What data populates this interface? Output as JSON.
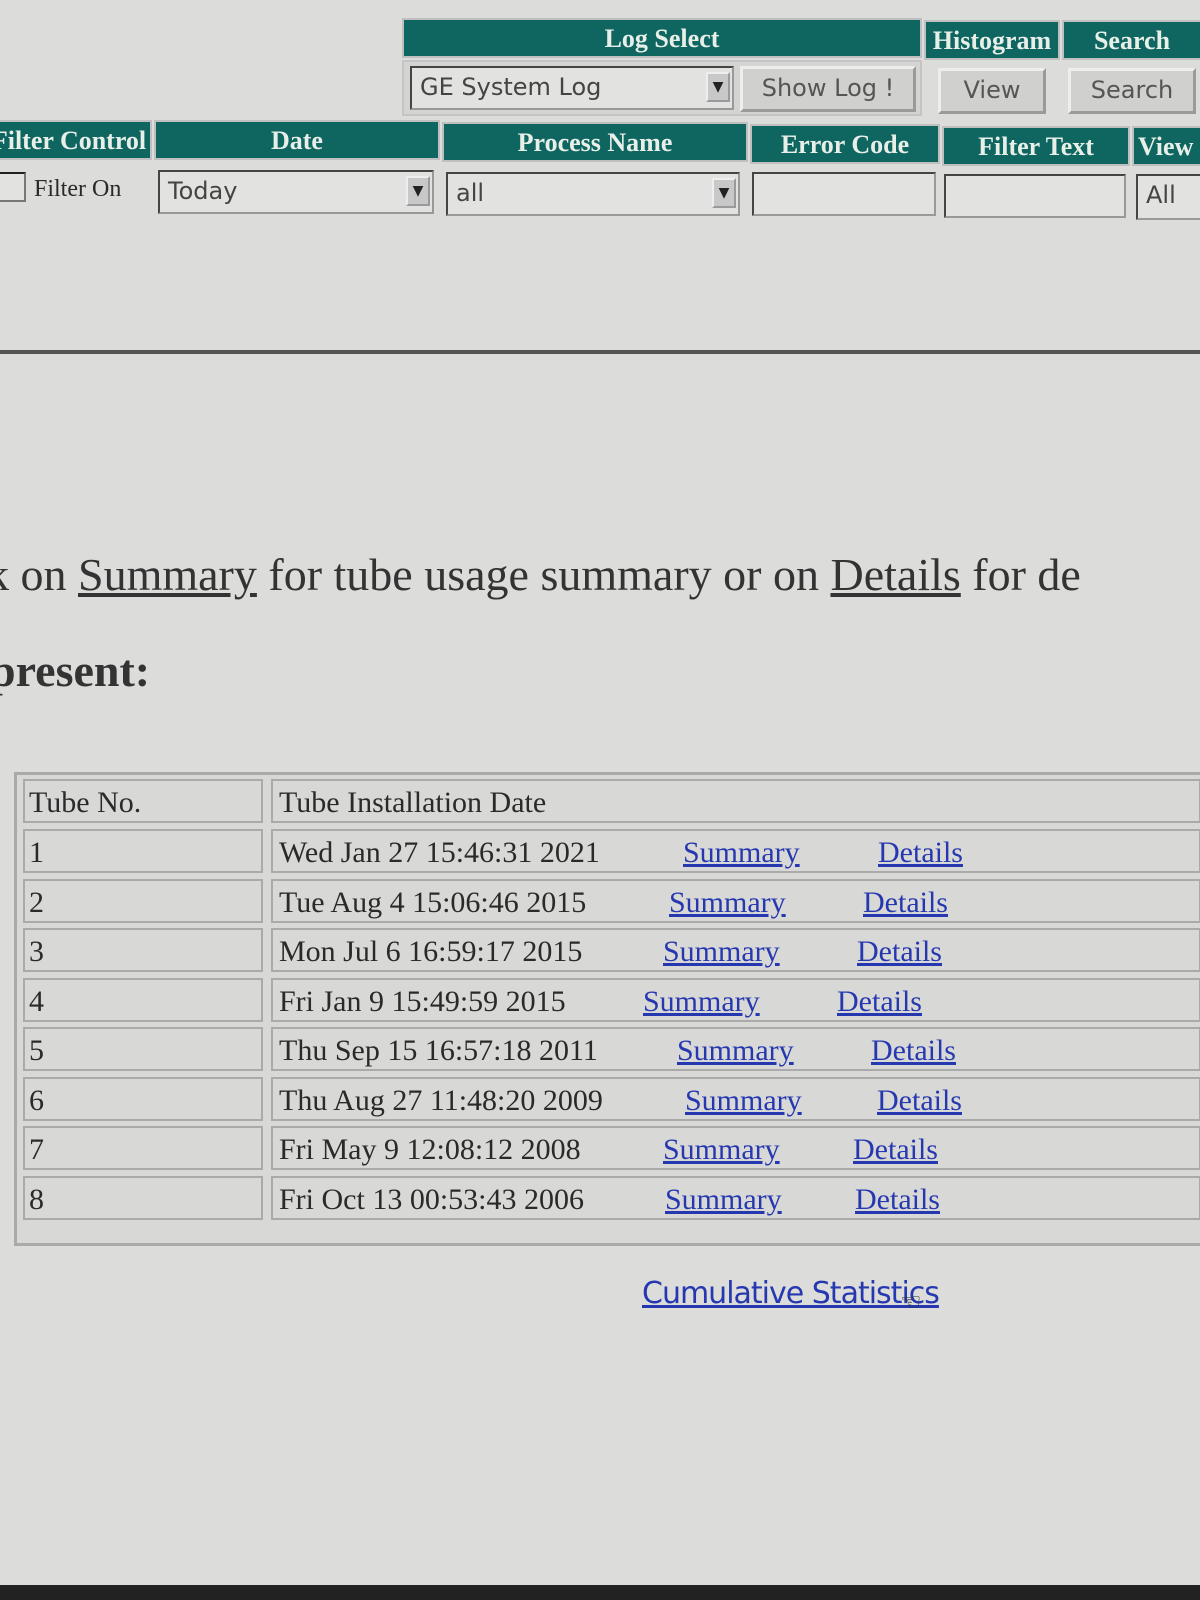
{
  "toolbar": {
    "log_select_header": "Log Select",
    "histogram_header": "Histogram",
    "search_header": "Search",
    "log_select_value": "GE System Log",
    "show_log_label": "Show Log !",
    "view_label": "View",
    "search_label": "Search"
  },
  "filters": {
    "filter_control_header": "Filter Control",
    "date_header": "Date",
    "process_name_header": "Process Name",
    "error_code_header": "Error Code",
    "filter_text_header": "Filter Text",
    "view_header": "View",
    "filter_on_label": "Filter On",
    "filter_on_checked": false,
    "date_value": "Today",
    "process_value": "all",
    "error_code_value": "",
    "filter_text_value": "",
    "view_value": "All"
  },
  "intro": {
    "prefix": "k on ",
    "summary_link": "Summary",
    "middle": " for tube usage summary or on ",
    "details_link": "Details",
    "suffix": " for de",
    "present": "present:"
  },
  "table": {
    "headers": [
      "Tube No.",
      "Tube Installation Date"
    ],
    "rows": [
      {
        "no": "1",
        "date": "Wed Jan 27 15:46:31 2021",
        "summary": "Summary",
        "details": "Details"
      },
      {
        "no": "2",
        "date": "Tue Aug 4 15:06:46 2015",
        "summary": "Summary",
        "details": "Details"
      },
      {
        "no": "3",
        "date": "Mon Jul 6 16:59:17 2015",
        "summary": "Summary",
        "details": "Details"
      },
      {
        "no": "4",
        "date": "Fri Jan 9 15:49:59 2015",
        "summary": "Summary",
        "details": "Details"
      },
      {
        "no": "5",
        "date": "Thu Sep 15 16:57:18 2011",
        "summary": "Summary",
        "details": "Details"
      },
      {
        "no": "6",
        "date": "Thu Aug 27 11:48:20 2009",
        "summary": "Summary",
        "details": "Details"
      },
      {
        "no": "7",
        "date": "Fri May 9 12:08:12 2008",
        "summary": "Summary",
        "details": "Details"
      },
      {
        "no": "8",
        "date": "Fri Oct 13 00:53:43 2006",
        "summary": "Summary",
        "details": "Details"
      }
    ]
  },
  "cumulative_link": "Cumulative Statistics",
  "colors": {
    "header": "#0f6660",
    "link": "#2638b0"
  }
}
